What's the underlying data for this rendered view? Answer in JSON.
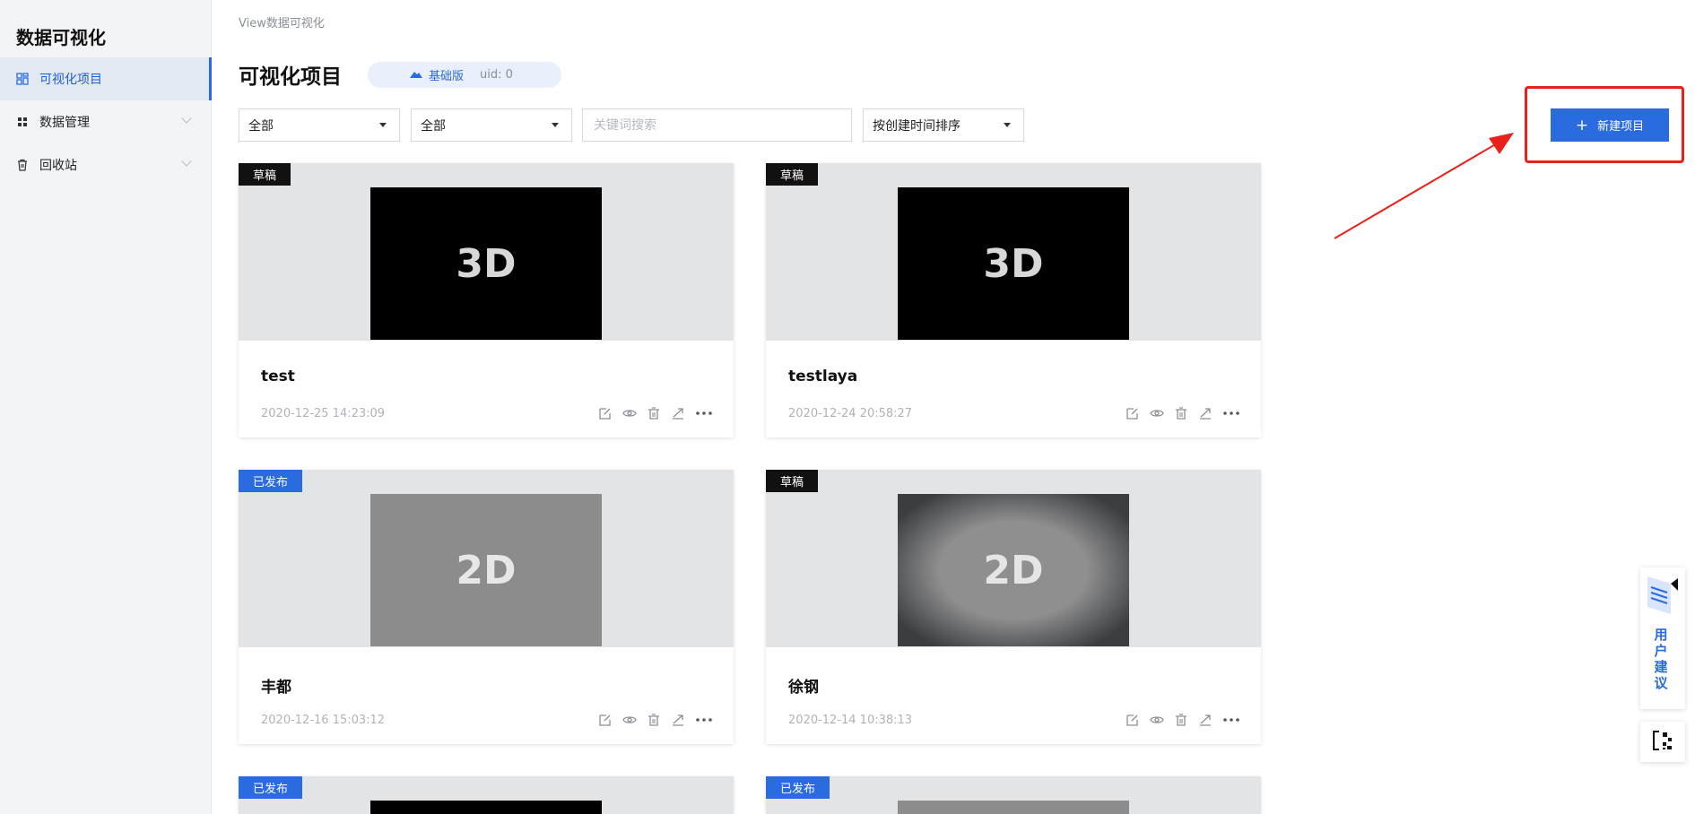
{
  "app": {
    "brand": "数据可视化"
  },
  "sidebar": {
    "items": [
      {
        "label": "可视化项目",
        "active": true
      },
      {
        "label": "数据管理",
        "active": false
      },
      {
        "label": "回收站",
        "active": false
      }
    ]
  },
  "header": {
    "breadcrumb": "View数据可视化",
    "title": "可视化项目",
    "plan_name": "基础版",
    "uid": "uid: 0"
  },
  "filters": {
    "filter1": "全部",
    "filter2": "全部",
    "search_placeholder": "关键词搜索",
    "sort": "按创建时间排序"
  },
  "toolbar": {
    "new_project_label": "新建项目"
  },
  "projects": [
    {
      "name": "test",
      "date": "2020-12-25 14:23:09",
      "status": "草稿",
      "thumb": "3D"
    },
    {
      "name": "testlaya",
      "date": "2020-12-24 20:58:27",
      "status": "草稿",
      "thumb": "3D"
    },
    {
      "name": "丰都",
      "date": "2020-12-16 15:03:12",
      "status": "已发布",
      "thumb": "2D"
    },
    {
      "name": "徐钢",
      "date": "2020-12-14 10:38:13",
      "status": "草稿",
      "thumb": "2D"
    },
    {
      "status": "已发布"
    },
    {
      "status": "已发布"
    }
  ],
  "floating": {
    "feedback_label": "用户建议"
  },
  "colors": {
    "accent": "#2a6be0",
    "highlight": "#e8221b",
    "draft_badge": "#111111"
  }
}
